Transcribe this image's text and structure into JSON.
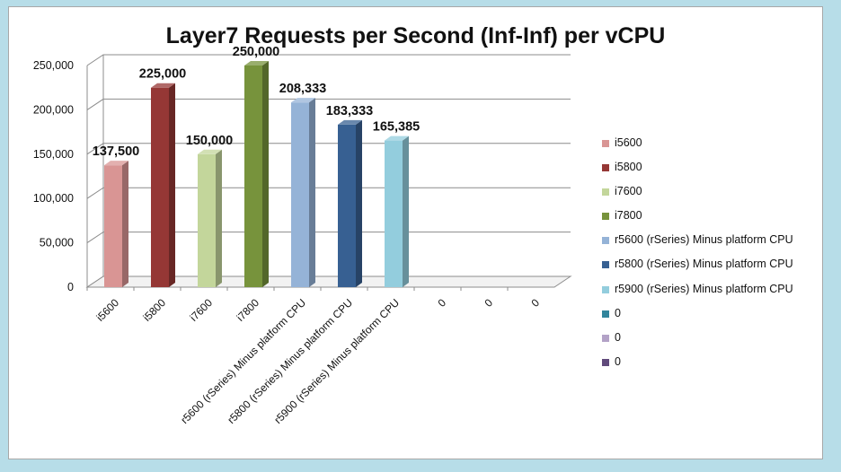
{
  "chart_data": {
    "type": "bar",
    "title": "Layer7 Requests per Second (Inf-Inf) per vCPU",
    "categories": [
      "i5600",
      "i5800",
      "i7600",
      "i7800",
      "r5600 (rSeries) Minus platform CPU",
      "r5800 (rSeries) Minus platform CPU",
      "r5900 (rSeries) Minus platform CPU",
      "0",
      "0",
      "0"
    ],
    "values": [
      137500,
      225000,
      150000,
      250000,
      208333,
      183333,
      165385,
      null,
      null,
      null
    ],
    "data_labels": [
      "137,500",
      "225,000",
      "150,000",
      "250,000",
      "208,333",
      "183,333",
      "165,385"
    ],
    "ylim": [
      0,
      250000
    ],
    "yticks": [
      "0",
      "50,000",
      "100,000",
      "150,000",
      "200,000",
      "250,000"
    ],
    "grid": true,
    "legend_position": "right",
    "legend": [
      {
        "name": "i5600",
        "color": "#d99594"
      },
      {
        "name": "i5800",
        "color": "#953735"
      },
      {
        "name": "i7600",
        "color": "#c3d69b"
      },
      {
        "name": "i7800",
        "color": "#77933c"
      },
      {
        "name": "r5600 (rSeries) Minus platform CPU",
        "color": "#95b3d7"
      },
      {
        "name": "r5800 (rSeries) Minus platform CPU",
        "color": "#376092"
      },
      {
        "name": "r5900 (rSeries) Minus platform CPU",
        "color": "#93cddd"
      },
      {
        "name": "0",
        "color": "#31859c"
      },
      {
        "name": "0",
        "color": "#b3a2c7"
      },
      {
        "name": "0",
        "color": "#604a7b"
      }
    ]
  }
}
